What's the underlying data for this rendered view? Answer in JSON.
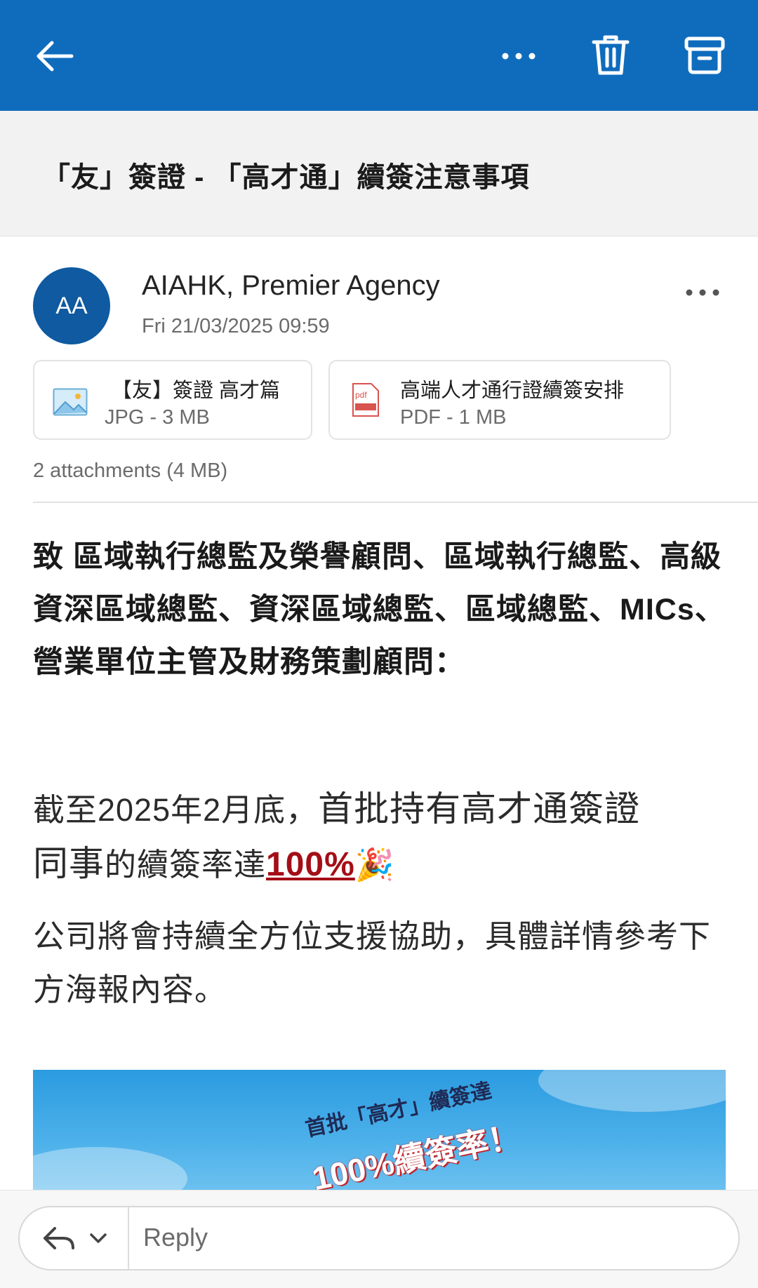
{
  "header": {
    "back_icon": "arrow-left-icon",
    "more_icon": "ellipsis-icon",
    "delete_icon": "trash-icon",
    "archive_icon": "archive-icon",
    "bar_color": "#0f6cbd"
  },
  "subject": "「友」簽證 - 「高才通」續簽注意事項",
  "message": {
    "avatar_initials": "AA",
    "avatar_color": "#0f5aa0",
    "sender": "AIAHK, Premier Agency",
    "date": "Fri 21/03/2025 09:59",
    "more_icon": "ellipsis-icon"
  },
  "attachments": [
    {
      "icon": "image-file-icon",
      "name": "【友】簽證 高才篇",
      "meta": "JPG - 3 MB"
    },
    {
      "icon": "pdf-file-icon",
      "name": "高端人才通行證續簽安排",
      "meta": "PDF - 1 MB"
    }
  ],
  "attachments_summary": "2 attachments (4 MB)",
  "body": {
    "greeting": "致 區域執行總監及榮譽顧問、區域執行總監、高級資深區域總監、資深區域總監、區域總監、MICs、營業單位主管及財務策劃顧問：",
    "p1_part1": "截至2025年2月底，",
    "p1_part2": "首批持有高才通簽證",
    "p1_part3": "同事",
    "p1_part4": "的續簽率達",
    "p1_highlight": "100%",
    "p1_emoji": "🎉",
    "p2": "公司將會持續全方位支援協助，具體詳情參考下方海報內容。",
    "poster_line1": "首批「高才」續簽達",
    "poster_line2": "100%續簽率！"
  },
  "footer": {
    "reply_icon": "reply-icon",
    "chevron_icon": "chevron-down-icon",
    "reply_placeholder": "Reply"
  }
}
